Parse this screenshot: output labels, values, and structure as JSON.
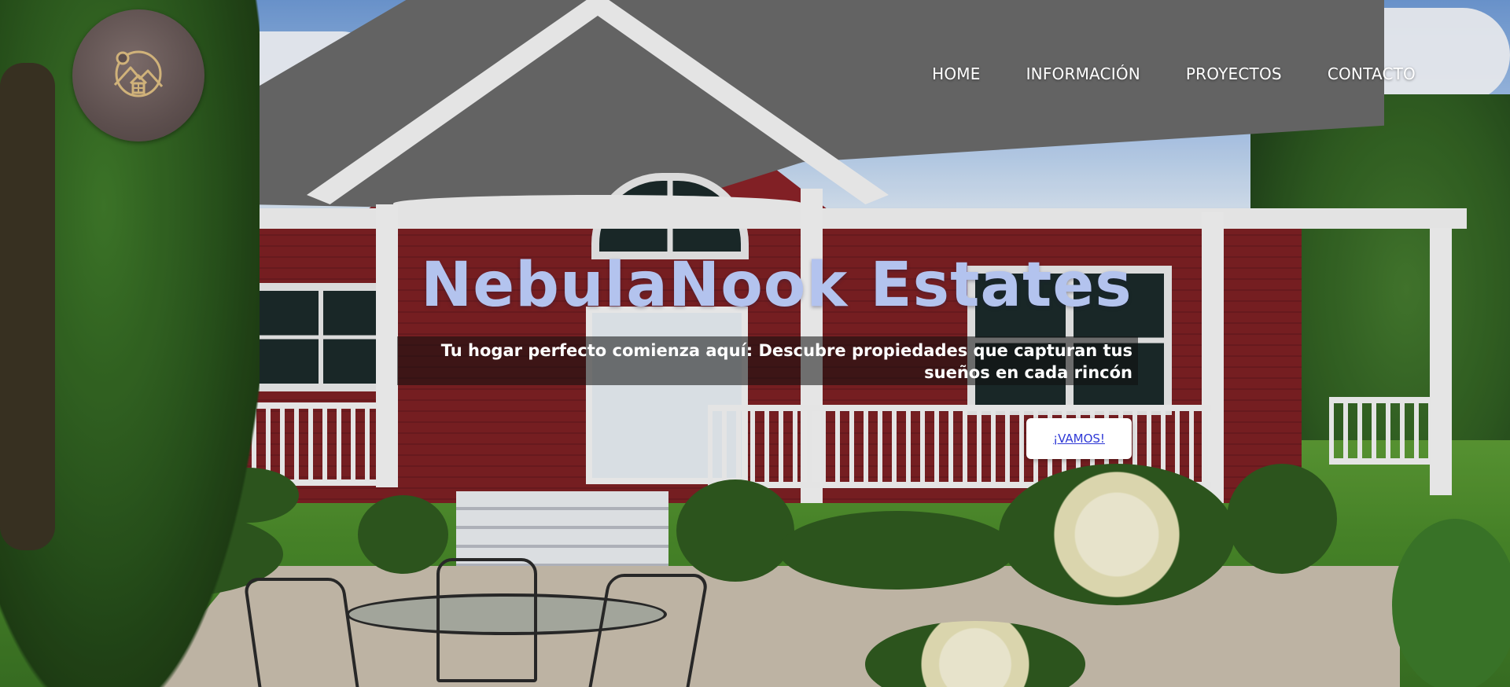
{
  "brand": {
    "logo_icon": "house-mountain-icon",
    "logo_color": "#d0b27a"
  },
  "nav": {
    "items": [
      {
        "label": "HOME"
      },
      {
        "label": "INFORMACIÓN"
      },
      {
        "label": "PROYECTOS"
      },
      {
        "label": "CONTACTO"
      }
    ]
  },
  "hero": {
    "title": "NebulaNook Estates",
    "subtitle": "Tu hogar perfecto comienza aquí: Descubre propiedades que capturan tus sueños en cada rincón",
    "cta_label": "¡VAMOS!",
    "title_color": "#b3c3ee",
    "cta_text_color": "#2f39d6"
  }
}
